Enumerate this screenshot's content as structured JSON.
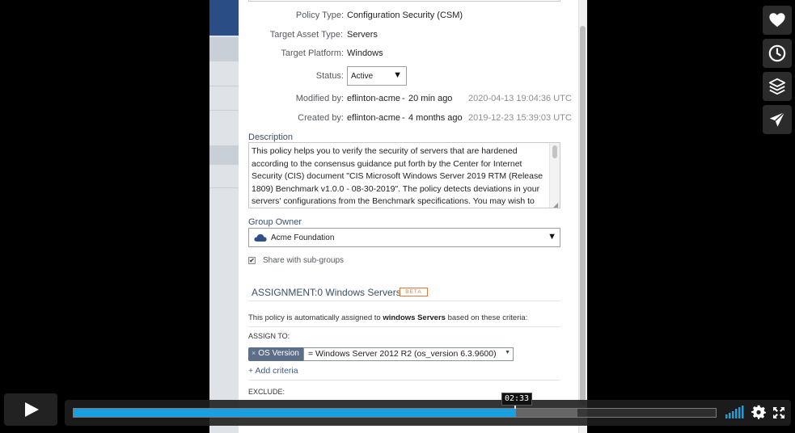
{
  "form": {
    "policy_type_label": "Policy Type:",
    "policy_type_value": "Configuration Security (CSM)",
    "target_asset_type_label": "Target Asset Type:",
    "target_asset_type_value": "Servers",
    "target_platform_label": "Target Platform:",
    "target_platform_value": "Windows",
    "status_label": "Status:",
    "status_value": "Active",
    "modified_label": "Modified by:",
    "modified_user": "eflinton-acme",
    "modified_sep": "-",
    "modified_ago": "20 min ago",
    "modified_timestamp": "2020-04-13 19:04:36 UTC",
    "created_label": "Created by:",
    "created_user": "eflinton-acme",
    "created_sep": "-",
    "created_ago": "4 months ago",
    "created_timestamp": "2019-12-23 15:39:03 UTC",
    "description_label": "Description",
    "description_text": "This policy helps you to verify the security of servers that are hardened according to the consensus guidance put forth by the Center for Internet Security (CIS) document \"CIS Microsoft Windows Server 2019 RTM (Release 1809) Benchmark v1.0.0 - 08-30-2019\". The policy detects deviations in your servers' configurations from the Benchmark specifications. You may wish to",
    "group_owner_label": "Group Owner",
    "group_owner_value": "Acme Foundation",
    "share_label": "Share with sub-groups",
    "share_checked": true
  },
  "assignment": {
    "title_prefix": "ASSIGNMENT:",
    "title_count": "0 Windows Servers",
    "beta_badge": "BETA",
    "auto_text_pre": "This policy is automatically assigned to ",
    "auto_text_bold": "windows Servers",
    "auto_text_post": " based on these criteria:",
    "assign_to_label": "ASSIGN TO:",
    "criteria_remove": "×",
    "criteria_key": "OS Version",
    "criteria_value": "=  Windows Server 2012 R2 (os_version 6.3.9600)",
    "add_criteria": "+ Add criteria",
    "exclude_label": "EXCLUDE:"
  },
  "player": {
    "time_tooltip": "02:33",
    "progress_fraction": 0.689,
    "loaded_fraction": 0.785,
    "accent_color": "#1a9fe0",
    "side_buttons": [
      "heart-icon",
      "clock-icon",
      "layers-icon",
      "send-icon"
    ],
    "controls": [
      "play-icon",
      "volume-icon",
      "settings-icon",
      "fullscreen-icon"
    ]
  }
}
